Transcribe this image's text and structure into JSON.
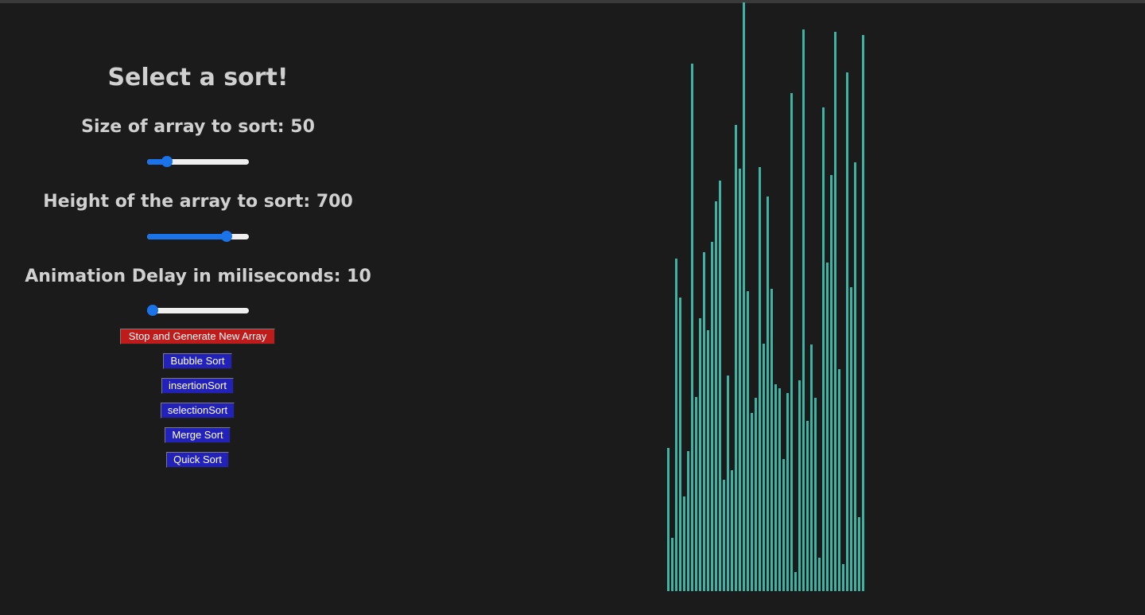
{
  "controls": {
    "title": "Select a sort!",
    "size_label": "Size of array to sort: 50",
    "height_label": "Height of the array to sort: 700",
    "delay_label": "Animation Delay in miliseconds: 10",
    "size_slider": {
      "value": 50,
      "fraction": 0.16
    },
    "height_slider": {
      "value": 700,
      "fraction": 0.82
    },
    "delay_slider": {
      "value": 10,
      "fraction": 0.0
    },
    "accent_color": "#1a73e8"
  },
  "buttons": {
    "generate": "Stop and Generate New Array",
    "bubble": "Bubble Sort",
    "insertion": "insertionSort",
    "selection": "selectionSort",
    "merge": "Merge Sort",
    "quick": "Quick Sort"
  },
  "colors": {
    "background": "#1b1b1b",
    "bar": "#3cb3a3",
    "generate_button": "#c01b1b",
    "sort_button": "#2222bb"
  },
  "chart_data": {
    "type": "bar",
    "ylim": [
      0,
      700
    ],
    "values": [
      170,
      63,
      394,
      348,
      112,
      166,
      625,
      230,
      323,
      401,
      309,
      414,
      462,
      486,
      132,
      255,
      143,
      552,
      500,
      697,
      355,
      211,
      229,
      502,
      293,
      467,
      358,
      245,
      240,
      156,
      235,
      590,
      23,
      250,
      665,
      202,
      292,
      229,
      40,
      573,
      389,
      493,
      662,
      263,
      32,
      614,
      360,
      508,
      88,
      659
    ]
  }
}
